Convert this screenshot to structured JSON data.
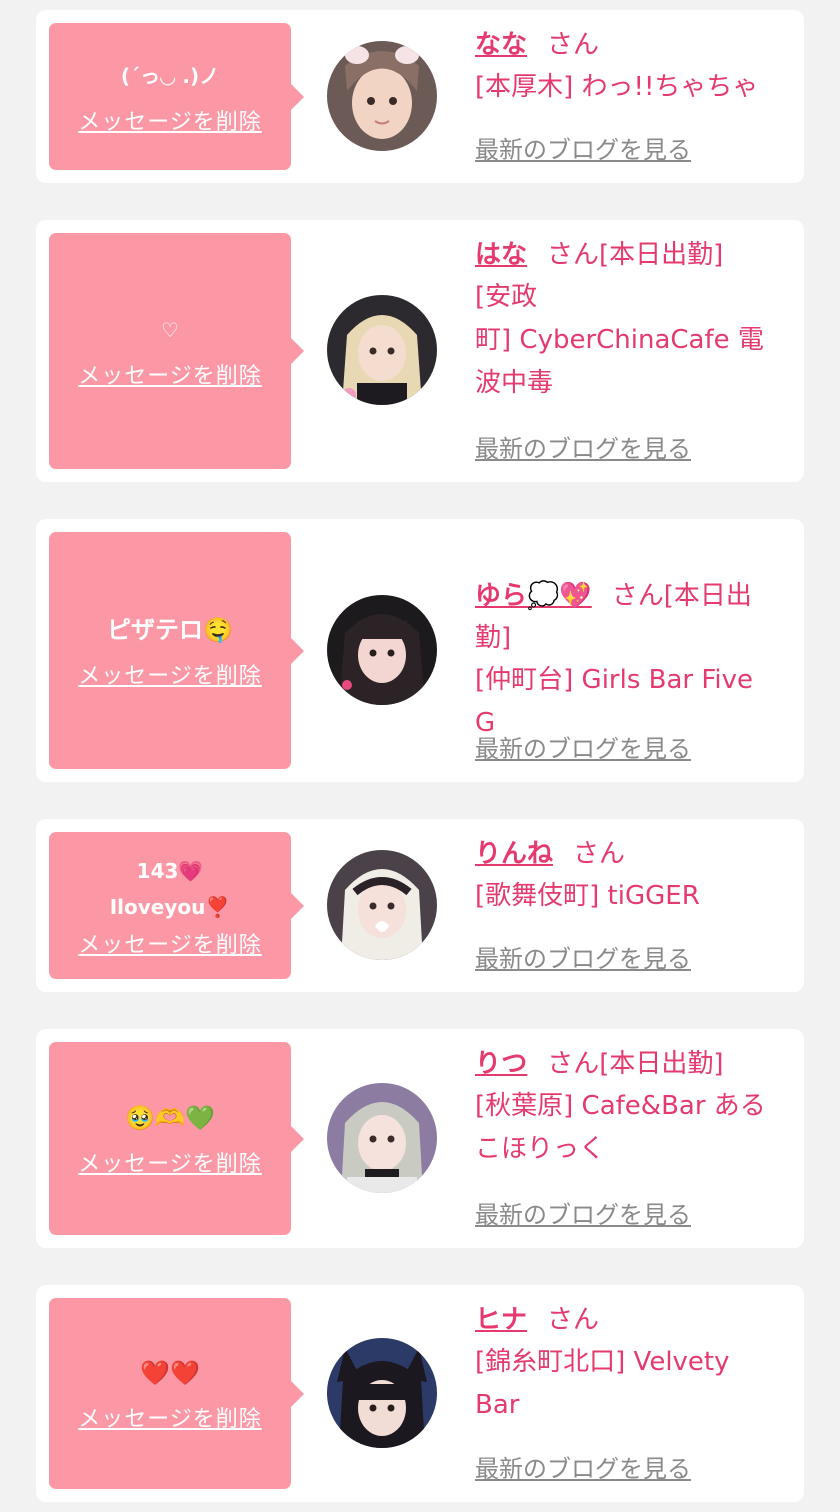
{
  "messages": [
    {
      "message": "(ˊっ◡ .)ノ",
      "delete_label": "メッセージを削除",
      "name": "なな",
      "honorific": "さん",
      "status": "",
      "shop": "[本厚木] わっ!!ちゃちゃ",
      "blog_label": "最新のブログを見る"
    },
    {
      "message": "♡",
      "delete_label": "メッセージを削除",
      "name": "はな",
      "honorific": "さん",
      "status": "[本日出勤]",
      "shop": "[安政\n町] CyberChinaCafe 電\n波中毒",
      "blog_label": "最新のブログを見る"
    },
    {
      "message": "ピザテロ🤤",
      "delete_label": "メッセージを削除",
      "name": "ゆら💭💖",
      "honorific": "さん",
      "status": "[本日出\n勤]",
      "shop": "[仲町台] Girls Bar Five\nG",
      "blog_label": "最新のブログを見る"
    },
    {
      "message": "143💗\nIloveyou❣️",
      "delete_label": "メッセージを削除",
      "name": "りんね",
      "honorific": "さん",
      "status": "",
      "shop": "[歌舞伎町] tiGGER",
      "blog_label": "最新のブログを見る"
    },
    {
      "message": "🥹🫶💚",
      "delete_label": "メッセージを削除",
      "name": "りつ",
      "honorific": "さん",
      "status": "[本日出勤]",
      "shop": "[秋葉原] Cafe&Bar ある\nこほりっく",
      "blog_label": "最新のブログを見る"
    },
    {
      "message": "❤️❤️",
      "delete_label": "メッセージを削除",
      "name": "ヒナ",
      "honorific": "さん",
      "status": "",
      "shop": "[錦糸町北口] Velvety\nBar",
      "blog_label": "最新のブログを見る"
    }
  ],
  "colors": {
    "page_background": "#f2f2f2",
    "bubble": "#fc98a5",
    "accent_pink": "#e53a6e",
    "link_gray": "#8a8a8a"
  }
}
